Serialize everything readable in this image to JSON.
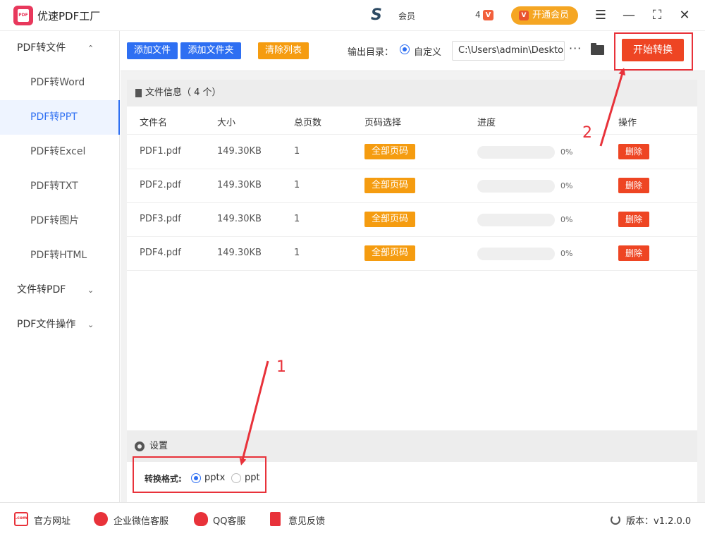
{
  "titlebar": {
    "app_title": "优速PDF工厂",
    "logo_text": "PDF",
    "user_logo": "S",
    "user_name": "会员",
    "badge_count": "4",
    "badge_icon": "V",
    "vip_label": "开通会员",
    "vip_icon": "V",
    "menu_glyph": "☰",
    "min_glyph": "—",
    "max_glyph": "⛶",
    "close_glyph": "✕"
  },
  "sidebar": {
    "groups": [
      {
        "label": "PDF转文件",
        "expanded": true
      },
      {
        "label": "文件转PDF",
        "expanded": false
      },
      {
        "label": "PDF文件操作",
        "expanded": false
      }
    ],
    "items": [
      "PDF转Word",
      "PDF转PPT",
      "PDF转Excel",
      "PDF转TXT",
      "PDF转图片",
      "PDF转HTML"
    ],
    "active_item": "PDF转PPT",
    "chevron_up": "⌃",
    "chevron_down": "⌄"
  },
  "toolbar": {
    "add_file": "添加文件",
    "add_folder": "添加文件夹",
    "clear_list": "清除列表",
    "output_label": "输出目录：",
    "output_mode": "自定义",
    "output_path": "C:\\Users\\admin\\Deskto",
    "more_glyph": "···",
    "start_label": "开始转换",
    "colors": {
      "blue": "#2e6ff2",
      "orange": "#f59c10",
      "red": "#ee4523"
    }
  },
  "file_panel": {
    "title": "文件信息（ 4 个）",
    "columns": [
      "文件名",
      "大小",
      "总页数",
      "页码选择",
      "进度",
      "操作"
    ],
    "rows": [
      {
        "name": "PDF1.pdf",
        "size": "149.30KB",
        "pages": "1",
        "page_select": "全部页码",
        "progress": "0%",
        "action": "删除"
      },
      {
        "name": "PDF2.pdf",
        "size": "149.30KB",
        "pages": "1",
        "page_select": "全部页码",
        "progress": "0%",
        "action": "删除"
      },
      {
        "name": "PDF3.pdf",
        "size": "149.30KB",
        "pages": "1",
        "page_select": "全部页码",
        "progress": "0%",
        "action": "删除"
      },
      {
        "name": "PDF4.pdf",
        "size": "149.30KB",
        "pages": "1",
        "page_select": "全部页码",
        "progress": "0%",
        "action": "删除"
      }
    ]
  },
  "settings": {
    "title": "设置",
    "format_label": "转换格式:",
    "options": [
      "pptx",
      "ppt"
    ],
    "selected": "pptx"
  },
  "annotations": {
    "step1": "1",
    "step2": "2",
    "color": "#e8323a"
  },
  "footer": {
    "website": "官方网址",
    "website_icon": ".com",
    "wechat": "企业微信客服",
    "qq": "QQ客服",
    "feedback": "意见反馈",
    "version": "版本：v1.2.0.0"
  }
}
